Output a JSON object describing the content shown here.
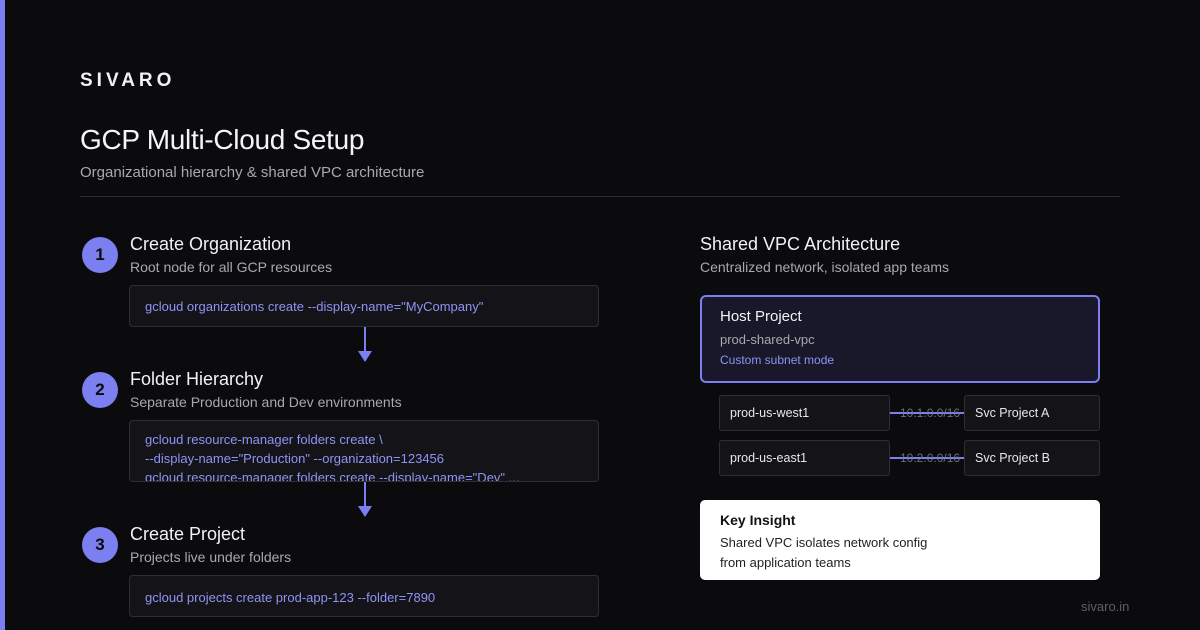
{
  "brand": "SIVARO",
  "title": "GCP Multi-Cloud Setup",
  "subtitle": "Organizational hierarchy & shared VPC architecture",
  "steps": [
    {
      "num": "1",
      "title": "Create Organization",
      "desc": "Root node for all GCP resources",
      "code": [
        "gcloud organizations create --display-name=\"MyCompany\""
      ]
    },
    {
      "num": "2",
      "title": "Folder Hierarchy",
      "desc": "Separate Production and Dev environments",
      "code": [
        "gcloud resource-manager folders create \\",
        "--display-name=\"Production\" --organization=123456",
        "gcloud resource-manager folders create --display-name=\"Dev\" ..."
      ]
    },
    {
      "num": "3",
      "title": "Create Project",
      "desc": "Projects live under folders",
      "code": [
        "gcloud projects create prod-app-123 --folder=7890"
      ]
    }
  ],
  "vpc": {
    "title": "Shared VPC Architecture",
    "desc": "Centralized network, isolated app teams",
    "host": {
      "title": "Host Project",
      "name": "prod-shared-vpc",
      "mode": "Custom subnet mode"
    },
    "subnets": [
      {
        "name": "prod-us-west1",
        "cidr": "10.1.0.0/16",
        "project": "Svc Project A"
      },
      {
        "name": "prod-us-east1",
        "cidr": "10.2.0.0/16",
        "project": "Svc Project B"
      }
    ]
  },
  "insight": {
    "title": "Key Insight",
    "lines": [
      "Shared VPC isolates network config",
      "from application teams"
    ]
  },
  "footer": "sivaro.in",
  "colors": {
    "accent": "#7b7ff0",
    "background": "#0b0b0d",
    "code": "#8f93f5"
  }
}
